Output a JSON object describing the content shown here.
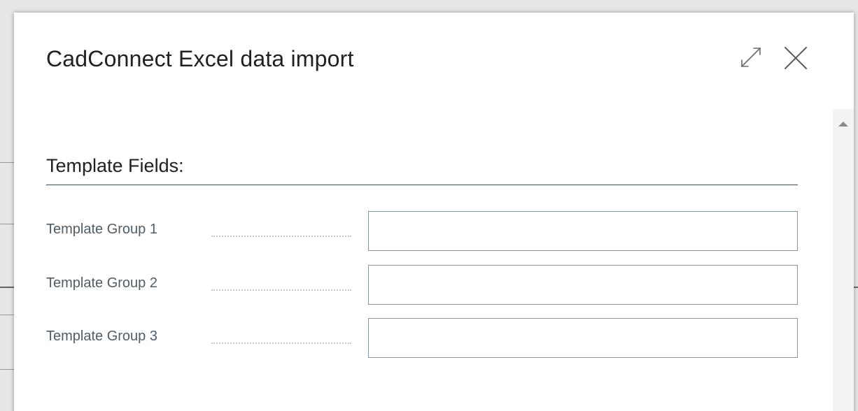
{
  "dialog": {
    "title": "CadConnect Excel data import",
    "expand_icon": "expand-diagonal-icon",
    "close_icon": "close-icon"
  },
  "section": {
    "title": "Template Fields:"
  },
  "fields": [
    {
      "label": "Template Group 1",
      "value": ""
    },
    {
      "label": "Template Group 2",
      "value": ""
    },
    {
      "label": "Template Group 3",
      "value": ""
    }
  ],
  "scrollbar": {
    "up_icon": "scroll-up-arrow-icon"
  }
}
